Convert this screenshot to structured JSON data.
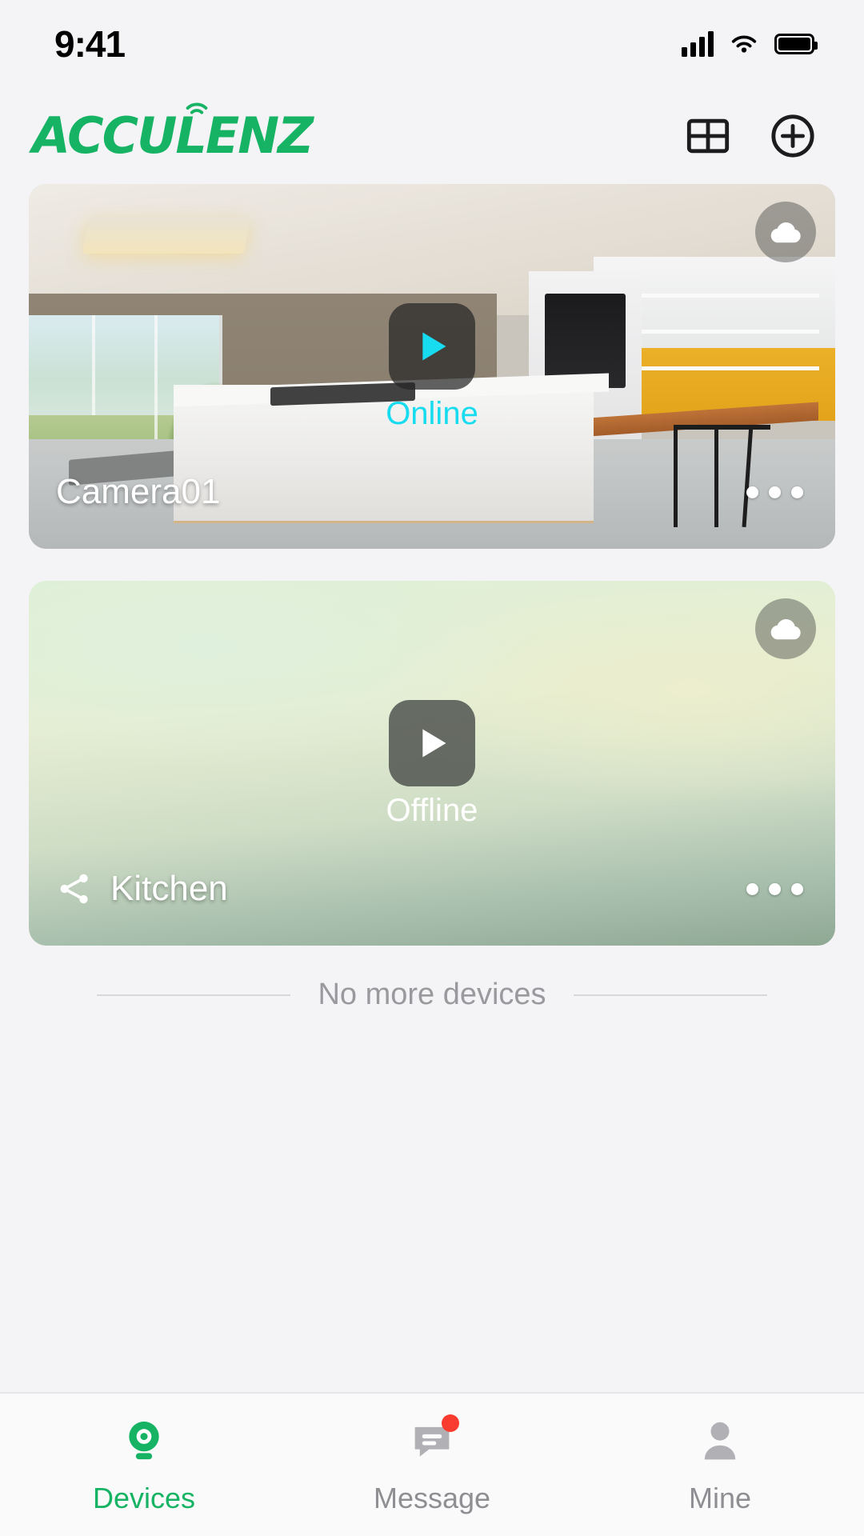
{
  "status_bar": {
    "time": "9:41",
    "signal_icon": "cellular-signal-icon",
    "wifi_icon": "wifi-icon",
    "battery_icon": "battery-full-icon"
  },
  "header": {
    "logo_text": "ACCULENZ",
    "logo_color": "#16b364",
    "grid_view_label": "grid-view-icon",
    "add_device_label": "add-device-icon"
  },
  "devices": [
    {
      "name": "Camera01",
      "status": "Online",
      "status_color": "#17dcf0",
      "cloud_icon": "cloud-icon",
      "play_icon": "play-icon",
      "play_color": "#17dcf0",
      "menu_icon": "more-options-icon",
      "shared": false
    },
    {
      "name": "Kitchen",
      "status": "Offline",
      "status_color": "#ffffff",
      "cloud_icon": "cloud-icon",
      "play_icon": "play-icon",
      "play_color": "#ffffff",
      "menu_icon": "more-options-icon",
      "shared": true,
      "share_icon": "share-icon"
    }
  ],
  "list_footer": {
    "text": "No more devices"
  },
  "tabbar": {
    "items": [
      {
        "label": "Devices",
        "icon": "camera-icon",
        "active": true,
        "badge": false
      },
      {
        "label": "Message",
        "icon": "message-icon",
        "active": false,
        "badge": true
      },
      {
        "label": "Mine",
        "icon": "person-icon",
        "active": false,
        "badge": false
      }
    ],
    "active_color": "#16b364",
    "inactive_color": "#8e8e93",
    "badge_color": "#fa3b30"
  }
}
